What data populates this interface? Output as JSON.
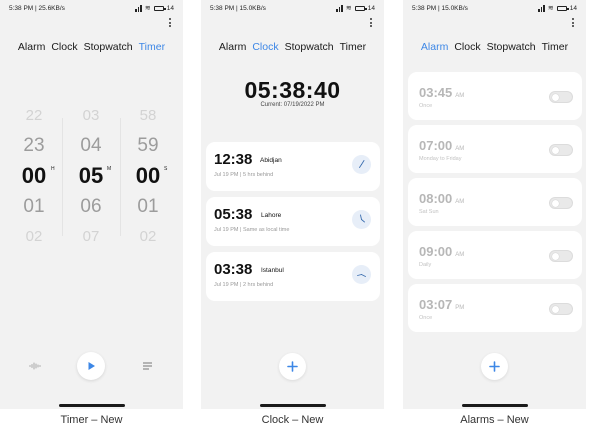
{
  "colors": {
    "accent": "#3d87e6",
    "screen_bg": "#f2f2f2",
    "card_bg": "#ffffff"
  },
  "timer_screen": {
    "caption": "Timer – New",
    "status": {
      "time": "5:38 PM",
      "speed": "25.6KB/s",
      "battery": "14"
    },
    "tabs": [
      "Alarm",
      "Clock",
      "Stopwatch",
      "Timer"
    ],
    "active_tab": "Timer",
    "picker": [
      {
        "unit": "H",
        "values": [
          "22",
          "23",
          "00",
          "01",
          "02"
        ]
      },
      {
        "unit": "M",
        "values": [
          "03",
          "04",
          "05",
          "06",
          "07"
        ]
      },
      {
        "unit": "S",
        "values": [
          "58",
          "59",
          "00",
          "01",
          "02"
        ]
      }
    ],
    "icons": {
      "sound": "waveform-icon",
      "play": "play-icon",
      "list": "list-icon"
    }
  },
  "clock_screen": {
    "caption": "Clock – New",
    "status": {
      "time": "5:38 PM",
      "speed": "15.0KB/s",
      "battery": "14"
    },
    "tabs": [
      "Alarm",
      "Clock",
      "Stopwatch",
      "Timer"
    ],
    "active_tab": "Clock",
    "current_time": "05:38:40",
    "current_label": "Current: 07/19/2022 PM",
    "cities": [
      {
        "time": "12:38",
        "name": "Abidjan",
        "date": "Jul 19 PM",
        "diff": "5 hrs behind"
      },
      {
        "time": "05:38",
        "name": "Lahore",
        "date": "Jul 19 PM",
        "diff": "Same as local time"
      },
      {
        "time": "03:38",
        "name": "Istanbul",
        "date": "Jul 19 PM",
        "diff": "2 hrs behind"
      }
    ]
  },
  "alarms_screen": {
    "caption": "Alarms – New",
    "status": {
      "time": "5:38 PM",
      "speed": "15.0KB/s",
      "battery": "14"
    },
    "tabs": [
      "Alarm",
      "Clock",
      "Stopwatch",
      "Timer"
    ],
    "active_tab": "Alarm",
    "alarms": [
      {
        "time": "03:45",
        "ampm": "AM",
        "repeat": "Once",
        "enabled": false
      },
      {
        "time": "07:00",
        "ampm": "AM",
        "repeat": "Monday to Friday",
        "enabled": false
      },
      {
        "time": "08:00",
        "ampm": "AM",
        "repeat": "Sat Sun",
        "enabled": false
      },
      {
        "time": "09:00",
        "ampm": "AM",
        "repeat": "Daily",
        "enabled": false
      },
      {
        "time": "03:07",
        "ampm": "PM",
        "repeat": "Once",
        "enabled": false
      }
    ]
  }
}
